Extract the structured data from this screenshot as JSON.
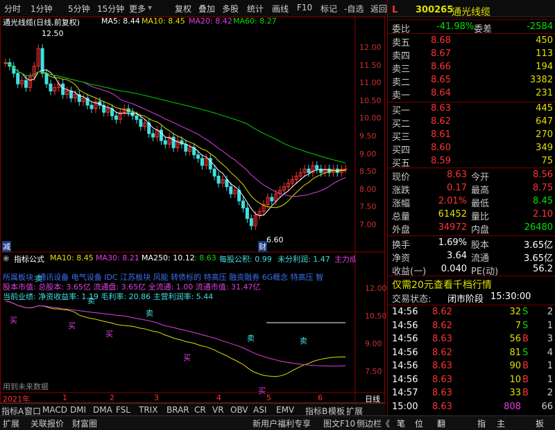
{
  "toolbar": {
    "left": [
      "分时",
      "1分钟",
      "5分钟",
      "15分钟",
      "更多"
    ],
    "right": [
      "复权",
      "叠加",
      "多股",
      "统计",
      "画线",
      "F10",
      "标记",
      "-自选",
      "返回"
    ]
  },
  "stock": {
    "flag": "L",
    "code": "300265",
    "name": "通光线缆"
  },
  "kline": {
    "title": "通光线缆(日线,前复权)",
    "ma5": "MA5: 8.44",
    "ma10": "MA10: 8.45",
    "ma20": "MA20: 8.42",
    "ma60": "MA60: 8.27",
    "yticks": [
      "12.00",
      "11.50",
      "11.00",
      "10.50",
      "10.00",
      "9.50",
      "9.00",
      "8.50",
      "8.00",
      "7.50",
      "7.00"
    ],
    "high_label": "12.50",
    "low_label": "6.60",
    "reduce_mark": "减",
    "cai_mark": "财",
    "highlight_color": "#ff3333",
    "down_color": "#40e0e0"
  },
  "indicator": {
    "title": "指标公式",
    "ma10": "MA10: 8.45",
    "ma30": "MA30: 8.21",
    "ma250": "MA250: 10.12",
    "val": ": 8.63",
    "per_share": "每股公积: 0.99",
    "undistributed": "未分利润: 1.47",
    "force": "主力成",
    "line1": "所属板块: 通讯设备 电气设备 IDC 江苏板块 风能 转债标的 特高压 融资融券 6G概念 特高压 智",
    "line2": "股本市值: 总股本: 3.65亿 流通盘: 3.65亿 全流通: 1.00 流通市值: 31.47亿",
    "line3": "当前业绩: 净资收益率: 1.19 毛利率: 20.86 主营利润率: 5.44",
    "yticks": [
      "12.00",
      "10.50",
      "9.00",
      "7.50"
    ],
    "buy": "买",
    "sell": "卖",
    "future_note": "用到未来数据"
  },
  "xaxis": {
    "year": "2021年",
    "months": [
      "1",
      "2",
      "3",
      "4",
      "5",
      "6"
    ],
    "period": "日线"
  },
  "tabs": [
    "指标A",
    "窗口",
    "MACD",
    "DMI",
    "DMA",
    "FSL",
    "TRIX",
    "BRAR",
    "CR",
    "VR",
    "OBV",
    "ASI",
    "EMV",
    "指标B",
    "模板",
    "扩展"
  ],
  "status": {
    "left": [
      "扩展",
      "关联报价",
      "财富圈"
    ],
    "promo": "新用户福利专享",
    "f10": "图文F10",
    "sidebar": "侧边栏《",
    "icons": [
      "笔",
      "位",
      "翻",
      "指",
      "主",
      "扳"
    ]
  },
  "orderbook": {
    "wei_bi_label": "委比",
    "wei_bi": "-41.98%",
    "wei_cha_label": "委差",
    "wei_cha": "-2584",
    "asks": [
      {
        "label": "卖五",
        "price": "8.68",
        "vol": "450"
      },
      {
        "label": "卖四",
        "price": "8.67",
        "vol": "113"
      },
      {
        "label": "卖三",
        "price": "8.66",
        "vol": "194"
      },
      {
        "label": "卖二",
        "price": "8.65",
        "vol": "3382"
      },
      {
        "label": "卖一",
        "price": "8.64",
        "vol": "231"
      }
    ],
    "bids": [
      {
        "label": "买一",
        "price": "8.63",
        "vol": "445"
      },
      {
        "label": "买二",
        "price": "8.62",
        "vol": "647"
      },
      {
        "label": "买三",
        "price": "8.61",
        "vol": "270"
      },
      {
        "label": "买四",
        "price": "8.60",
        "vol": "349"
      },
      {
        "label": "买五",
        "price": "8.59",
        "vol": "75"
      }
    ]
  },
  "quote": [
    {
      "l1": "现价",
      "v1": "8.63",
      "c1": "#ff3333",
      "l2": "今开",
      "v2": "8.56",
      "c2": "#ff3333"
    },
    {
      "l1": "涨跌",
      "v1": "0.17",
      "c1": "#ff3333",
      "l2": "最高",
      "v2": "8.75",
      "c2": "#ff3333"
    },
    {
      "l1": "涨幅",
      "v1": "2.01%",
      "c1": "#ff3333",
      "l2": "最低",
      "v2": "8.45",
      "c2": "#00e000"
    },
    {
      "l1": "总量",
      "v1": "61452",
      "c1": "#e0e000",
      "l2": "量比",
      "v2": "2.10",
      "c2": "#ff3333"
    },
    {
      "l1": "外盘",
      "v1": "34972",
      "c1": "#ff3333",
      "l2": "内盘",
      "v2": "26480",
      "c2": "#00e000"
    }
  ],
  "fund": [
    {
      "l1": "换手",
      "v1": "1.69%",
      "l2": "股本",
      "v2": "3.65亿"
    },
    {
      "l1": "净资",
      "v1": "3.64",
      "l2": "流通",
      "v2": "3.65亿"
    },
    {
      "l1": "收益(一)",
      "v1": "0.040",
      "l2": "PE(动)",
      "v2": "56.2"
    }
  ],
  "promo": {
    "text": "仅需20元查看千档行情",
    "state_label": "交易状态:",
    "state": "闭市阶段",
    "time": "15:30:00"
  },
  "ticks": [
    {
      "t": "14:56",
      "p": "8.62",
      "v": "32",
      "d": "S",
      "n": "2"
    },
    {
      "t": "14:56",
      "p": "8.62",
      "v": "7",
      "d": "S",
      "n": "1"
    },
    {
      "t": "14:56",
      "p": "8.63",
      "v": "56",
      "d": "B",
      "n": "3"
    },
    {
      "t": "14:56",
      "p": "8.62",
      "v": "81",
      "d": "S",
      "n": "4"
    },
    {
      "t": "14:56",
      "p": "8.63",
      "v": "90",
      "d": "B",
      "n": "1"
    },
    {
      "t": "14:56",
      "p": "8.63",
      "v": "10",
      "d": "B",
      "n": "1"
    },
    {
      "t": "14:57",
      "p": "8.63",
      "v": "33",
      "d": "B",
      "n": "2"
    },
    {
      "t": "15:00",
      "p": "8.63",
      "v": "808",
      "d": "",
      "n": "66"
    }
  ]
}
